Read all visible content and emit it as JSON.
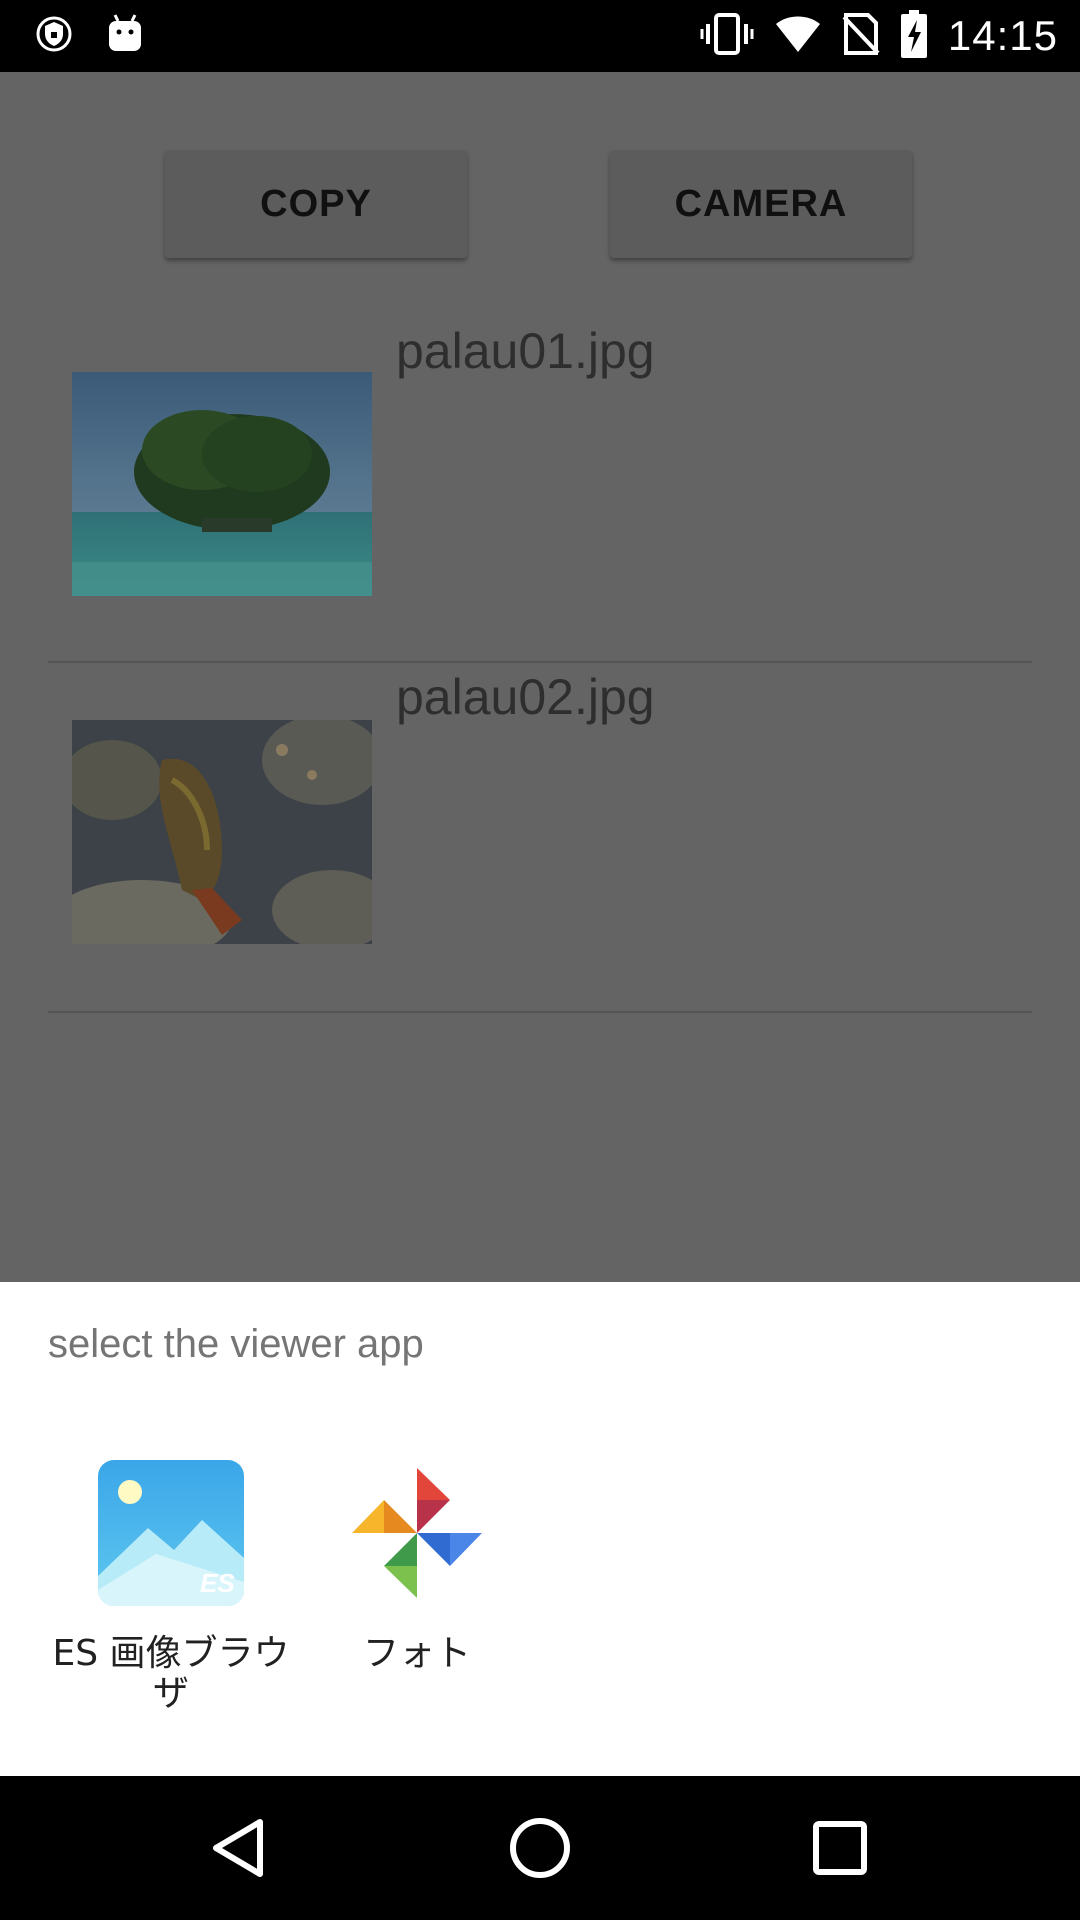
{
  "status_bar": {
    "time": "14:15",
    "left_icons": [
      "vpn-shield-icon",
      "android-icon"
    ],
    "right_icons": [
      "vibrate-icon",
      "wifi-icon",
      "no-sim-icon",
      "battery-charging-icon"
    ]
  },
  "app": {
    "buttons": {
      "copy_label": "COPY",
      "camera_label": "CAMERA"
    },
    "files": [
      {
        "name": "palau01.jpg",
        "thumbnail": "island-photo"
      },
      {
        "name": "palau02.jpg",
        "thumbnail": "fish-photo"
      }
    ]
  },
  "chooser": {
    "title": "select the viewer app",
    "apps": [
      {
        "label": "ES 画像ブラウザ",
        "icon": "es-gallery-icon"
      },
      {
        "label": "フォト",
        "icon": "google-photos-icon"
      }
    ]
  },
  "nav_bar": {
    "buttons": [
      "back-icon",
      "home-icon",
      "recents-icon"
    ]
  },
  "colors": {
    "scrim": "#646464",
    "sheet": "#ffffff",
    "bars": "#000000"
  }
}
